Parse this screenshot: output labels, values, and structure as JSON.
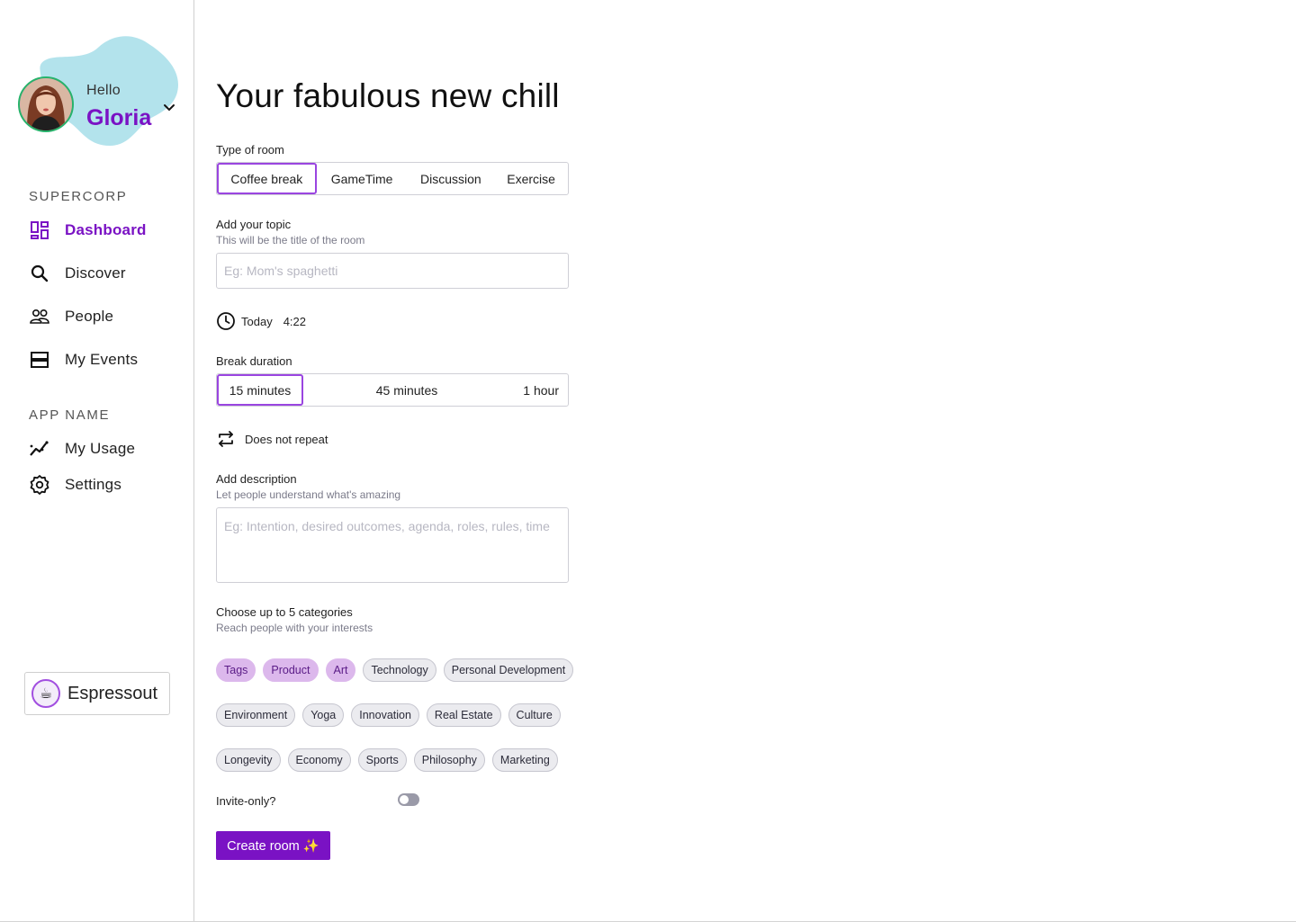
{
  "user": {
    "greeting": "Hello",
    "name": "Gloria"
  },
  "sidebar": {
    "org_section": "SUPERCORP",
    "items": [
      {
        "label": "Dashboard",
        "icon": "dashboard-icon",
        "active": true
      },
      {
        "label": "Discover",
        "icon": "search-icon"
      },
      {
        "label": "People",
        "icon": "people-icon"
      },
      {
        "label": "My Events",
        "icon": "events-icon"
      }
    ],
    "app_section": "APP NAME",
    "app_items": [
      {
        "label": "My Usage",
        "icon": "usage-icon"
      },
      {
        "label": "Settings",
        "icon": "settings-icon"
      }
    ],
    "org_switcher": {
      "logo": "☕",
      "name": "Espressout"
    }
  },
  "page": {
    "title": "Your fabulous new chill",
    "room_type": {
      "label": "Type of room",
      "options": [
        "Coffee break",
        "GameTime",
        "Discussion",
        "Exercise"
      ],
      "selected": "Coffee break"
    },
    "topic": {
      "label": "Add your topic",
      "hint": "This will be the title of the room",
      "placeholder": "Eg: Mom's spaghetti",
      "value": ""
    },
    "schedule": {
      "day": "Today",
      "time": "4:22"
    },
    "duration": {
      "label": "Break duration",
      "options": [
        "15 minutes",
        "45 minutes",
        "1 hour"
      ],
      "selected": "15 minutes"
    },
    "repeat": {
      "text": "Does not repeat"
    },
    "description": {
      "label": "Add description",
      "hint": "Let people understand what's amazing",
      "placeholder": "Eg: Intention, desired outcomes, agenda, roles, rules, time",
      "value": ""
    },
    "categories": {
      "label": "Choose up to 5 categories",
      "hint": "Reach people with your interests",
      "rows": [
        [
          "Tags",
          "Product",
          "Art",
          "Technology",
          "Personal Development"
        ],
        [
          "Environment",
          "Yoga",
          "Innovation",
          "Real Estate",
          "Culture"
        ],
        [
          "Longevity",
          "Economy",
          "Sports",
          "Philosophy",
          "Marketing"
        ]
      ],
      "selected": [
        "Tags",
        "Product",
        "Art"
      ]
    },
    "invite_only": {
      "label": "Invite-only?",
      "enabled": false
    },
    "create_button": "Create room ✨"
  },
  "colors": {
    "accent": "#7a12c4",
    "selected_chip": "#dcb8ec",
    "blob": "#b3e3ec"
  }
}
